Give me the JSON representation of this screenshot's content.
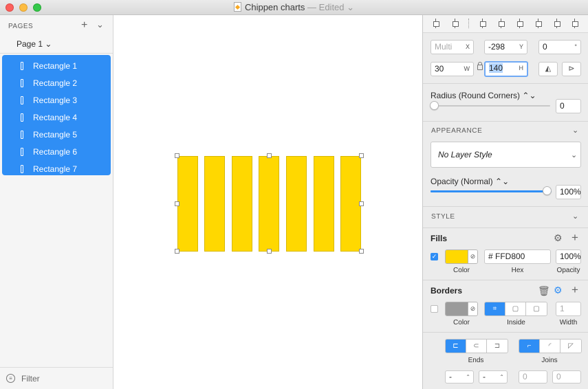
{
  "window": {
    "title": "Chippen charts",
    "status": "— Edited ⌄"
  },
  "sidebar": {
    "pages_label": "PAGES",
    "add_icon": "+",
    "collapse_icon": "⌄",
    "current_page": "Page 1 ⌄",
    "layers": [
      {
        "label": "Rectangle 1"
      },
      {
        "label": "Rectangle 2"
      },
      {
        "label": "Rectangle 3"
      },
      {
        "label": "Rectangle 4"
      },
      {
        "label": "Rectangle 5"
      },
      {
        "label": "Rectangle 6"
      },
      {
        "label": "Rectangle 7"
      }
    ],
    "filter_label": "Filter"
  },
  "canvas": {
    "fill_color": "#FFD800",
    "bar_count": 7
  },
  "inspector": {
    "position": {
      "x_value": "Multi",
      "x_unit": "X",
      "y_value": "-298",
      "y_unit": "Y",
      "rotation_value": "0",
      "rotation_unit": "°",
      "w_value": "30",
      "w_unit": "W",
      "h_value": "140",
      "h_unit": "H"
    },
    "radius_label": "Radius (Round Corners) ⌃⌄",
    "radius_value": "0",
    "appearance_head": "APPEARANCE",
    "layer_style": "No Layer Style",
    "opacity_label": "Opacity (Normal) ⌃⌄",
    "opacity_value": "100%",
    "opacity_level": 1.0,
    "style_head": "STYLE",
    "fills": {
      "head": "Fills",
      "color": "#FFD800",
      "hex_value": "# FFD800",
      "opacity_value": "100%",
      "color_caption": "Color",
      "hex_caption": "Hex",
      "opacity_caption": "Opacity"
    },
    "borders": {
      "head": "Borders",
      "color": "#9b9b9b",
      "width_value": "1",
      "color_caption": "Color",
      "position_caption": "Inside",
      "width_caption": "Width"
    },
    "ends_caption": "Ends",
    "joins_caption": "Joins",
    "dash_a": "-",
    "dash_b": "-",
    "gap_a": "0",
    "gap_b": "0"
  }
}
